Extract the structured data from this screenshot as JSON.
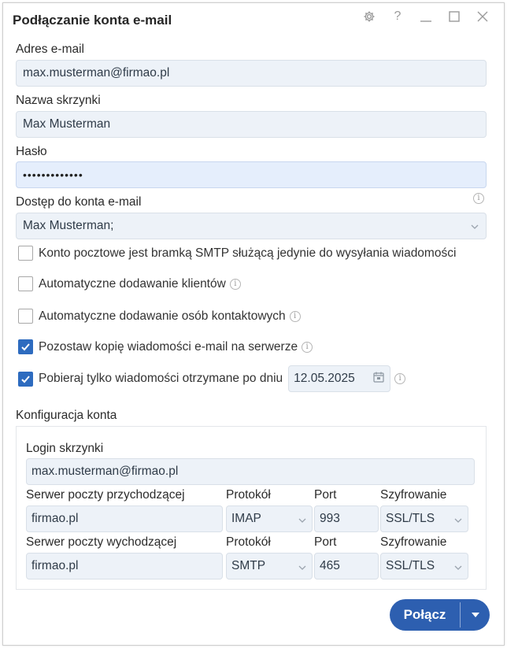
{
  "window": {
    "title": "Podłączanie konta e-mail",
    "controls": [
      "gear-icon",
      "help-icon",
      "minimize-icon",
      "maximize-icon",
      "close-icon"
    ],
    "help_label": "?"
  },
  "form": {
    "email_label": "Adres e-mail",
    "email_value": "max.musterman@firmao.pl",
    "mailbox_name_label": "Nazwa skrzynki",
    "mailbox_name_value": "Max Musterman",
    "password_label": "Hasło",
    "password_value": "•••••••••••••",
    "access_label": "Dostęp do konta e-mail",
    "access_value": "Max Musterman;"
  },
  "options": {
    "smtp_only": {
      "label": "Konto pocztowe jest bramką SMTP służącą jedynie do wysyłania wiadomości",
      "checked": false
    },
    "auto_clients": {
      "label": "Automatyczne dodawanie klientów",
      "checked": false
    },
    "auto_contacts": {
      "label": "Automatyczne dodawanie osób kontaktowych",
      "checked": false
    },
    "keep_copy": {
      "label": "Pozostaw kopię wiadomości e-mail na serwerze",
      "checked": true
    },
    "fetch_after": {
      "label": "Pobieraj tylko wiadomości otrzymane po dniu",
      "checked": true,
      "date": "12.05.2025"
    }
  },
  "config": {
    "section_label": "Konfiguracja konta",
    "login_label": "Login skrzynki",
    "login_value": "max.musterman@firmao.pl",
    "incoming": {
      "server_label": "Serwer poczty przychodzącej",
      "server_value": "firmao.pl",
      "protocol_label": "Protokół",
      "protocol_value": "IMAP",
      "port_label": "Port",
      "port_value": "993",
      "encryption_label": "Szyfrowanie",
      "encryption_value": "SSL/TLS"
    },
    "outgoing": {
      "server_label": "Serwer poczty wychodzącej",
      "server_value": "firmao.pl",
      "protocol_label": "Protokół",
      "protocol_value": "SMTP",
      "port_label": "Port",
      "port_value": "465",
      "encryption_label": "Szyfrowanie",
      "encryption_value": "SSL/TLS"
    }
  },
  "actions": {
    "connect_label": "Połącz"
  },
  "colors": {
    "primary": "#2d5fb0",
    "checkbox_checked": "#2d6bbf",
    "field_bg": "#edf2f8"
  }
}
